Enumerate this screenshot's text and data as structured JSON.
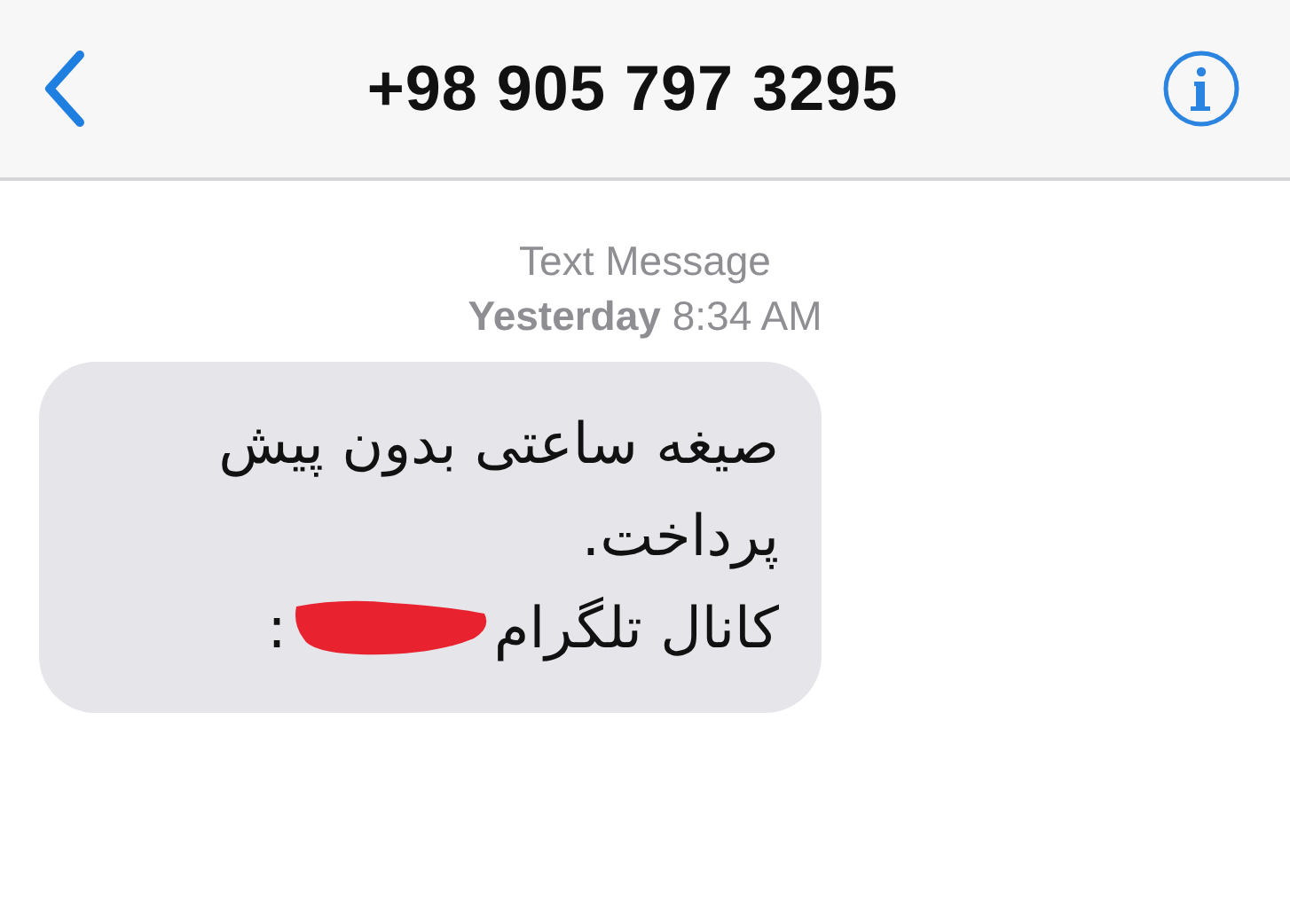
{
  "header": {
    "title": "+98 905 797 3295"
  },
  "timestamp": {
    "label": "Text Message",
    "day": "Yesterday",
    "time": "8:34 AM"
  },
  "messages": [
    {
      "kind": "received",
      "lines": [
        {
          "text": "صیغه ساعتی بدون پیش",
          "redacted": false
        },
        {
          "text": "پرداخت.",
          "redacted": false
        },
        {
          "text": "کانال تلگرام",
          "redacted": true,
          "suffix": ":"
        }
      ]
    }
  ]
}
